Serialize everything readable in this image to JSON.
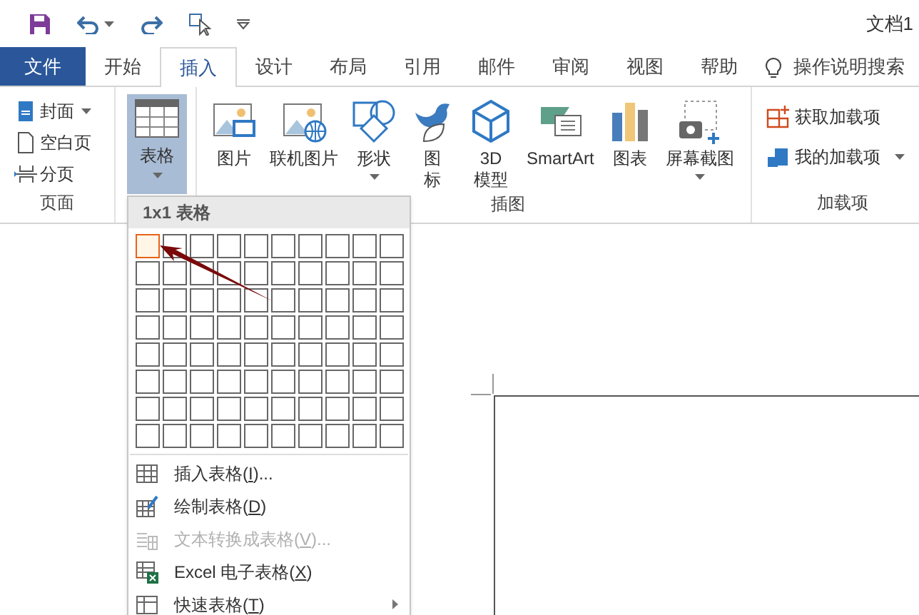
{
  "document_title": "文档1",
  "tabs": [
    {
      "label": "文件",
      "kind": "file",
      "selected": false
    },
    {
      "label": "开始",
      "kind": "tab",
      "selected": false
    },
    {
      "label": "插入",
      "kind": "tab",
      "selected": true
    },
    {
      "label": "设计",
      "kind": "tab",
      "selected": false
    },
    {
      "label": "布局",
      "kind": "tab",
      "selected": false
    },
    {
      "label": "引用",
      "kind": "tab",
      "selected": false
    },
    {
      "label": "邮件",
      "kind": "tab",
      "selected": false
    },
    {
      "label": "审阅",
      "kind": "tab",
      "selected": false
    },
    {
      "label": "视图",
      "kind": "tab",
      "selected": false
    },
    {
      "label": "帮助",
      "kind": "tab",
      "selected": false
    }
  ],
  "tell_me": "操作说明搜索",
  "ribbon": {
    "pages_group": {
      "label": "页面",
      "items": [
        {
          "label": "封面",
          "kind": "cover",
          "dropdown": true
        },
        {
          "label": "空白页",
          "kind": "blank",
          "dropdown": false
        },
        {
          "label": "分页",
          "kind": "break",
          "dropdown": false
        }
      ]
    },
    "table_button": {
      "label": "表格",
      "pressed": true
    },
    "illustrations_group": {
      "label": "插图",
      "items": [
        {
          "lines": [
            "图片"
          ],
          "kind": "picture",
          "dropdown": false
        },
        {
          "lines": [
            "联机图片"
          ],
          "kind": "online",
          "dropdown": false
        },
        {
          "lines": [
            "形状"
          ],
          "kind": "shapes",
          "dropdown": true
        },
        {
          "lines": [
            "图",
            "标"
          ],
          "kind": "icons",
          "dropdown": false
        },
        {
          "lines": [
            "3D",
            "模型"
          ],
          "kind": "model",
          "dropdown": false
        },
        {
          "lines": [
            "SmartArt"
          ],
          "kind": "smartart",
          "dropdown": false
        },
        {
          "lines": [
            "图表"
          ],
          "kind": "chart",
          "dropdown": false
        },
        {
          "lines": [
            "屏幕截图"
          ],
          "kind": "screenshot",
          "dropdown": true
        }
      ]
    },
    "addins_group": {
      "label": "加载项",
      "items": [
        {
          "label": "获取加载项",
          "kind": "store",
          "dropdown": false
        },
        {
          "label": "我的加载项",
          "kind": "mine",
          "dropdown": true
        }
      ]
    }
  },
  "table_menu": {
    "header": "1x1 表格",
    "grid": [
      {
        "cells": [
          {
            "selected": true
          },
          {
            "selected": false
          },
          {
            "selected": false
          },
          {
            "selected": false
          },
          {
            "selected": false
          },
          {
            "selected": false
          },
          {
            "selected": false
          },
          {
            "selected": false
          },
          {
            "selected": false
          },
          {
            "selected": false
          }
        ]
      },
      {
        "cells": [
          {
            "selected": false
          },
          {
            "selected": false
          },
          {
            "selected": false
          },
          {
            "selected": false
          },
          {
            "selected": false
          },
          {
            "selected": false
          },
          {
            "selected": false
          },
          {
            "selected": false
          },
          {
            "selected": false
          },
          {
            "selected": false
          }
        ]
      },
      {
        "cells": [
          {
            "selected": false
          },
          {
            "selected": false
          },
          {
            "selected": false
          },
          {
            "selected": false
          },
          {
            "selected": false
          },
          {
            "selected": false
          },
          {
            "selected": false
          },
          {
            "selected": false
          },
          {
            "selected": false
          },
          {
            "selected": false
          }
        ]
      },
      {
        "cells": [
          {
            "selected": false
          },
          {
            "selected": false
          },
          {
            "selected": false
          },
          {
            "selected": false
          },
          {
            "selected": false
          },
          {
            "selected": false
          },
          {
            "selected": false
          },
          {
            "selected": false
          },
          {
            "selected": false
          },
          {
            "selected": false
          }
        ]
      },
      {
        "cells": [
          {
            "selected": false
          },
          {
            "selected": false
          },
          {
            "selected": false
          },
          {
            "selected": false
          },
          {
            "selected": false
          },
          {
            "selected": false
          },
          {
            "selected": false
          },
          {
            "selected": false
          },
          {
            "selected": false
          },
          {
            "selected": false
          }
        ]
      },
      {
        "cells": [
          {
            "selected": false
          },
          {
            "selected": false
          },
          {
            "selected": false
          },
          {
            "selected": false
          },
          {
            "selected": false
          },
          {
            "selected": false
          },
          {
            "selected": false
          },
          {
            "selected": false
          },
          {
            "selected": false
          },
          {
            "selected": false
          }
        ]
      },
      {
        "cells": [
          {
            "selected": false
          },
          {
            "selected": false
          },
          {
            "selected": false
          },
          {
            "selected": false
          },
          {
            "selected": false
          },
          {
            "selected": false
          },
          {
            "selected": false
          },
          {
            "selected": false
          },
          {
            "selected": false
          },
          {
            "selected": false
          }
        ]
      },
      {
        "cells": [
          {
            "selected": false
          },
          {
            "selected": false
          },
          {
            "selected": false
          },
          {
            "selected": false
          },
          {
            "selected": false
          },
          {
            "selected": false
          },
          {
            "selected": false
          },
          {
            "selected": false
          },
          {
            "selected": false
          },
          {
            "selected": false
          }
        ]
      }
    ],
    "items": [
      {
        "text": "插入表格(",
        "accel": "I",
        "rest": ")...",
        "kind": "grid",
        "disabled": false,
        "submenu": false
      },
      {
        "text": "绘制表格(",
        "accel": "D",
        "rest": ")",
        "kind": "pencil",
        "disabled": false,
        "submenu": false
      },
      {
        "text": "文本转换成表格(",
        "accel": "V",
        "rest": ")...",
        "kind": "convert",
        "disabled": true,
        "submenu": false
      },
      {
        "text": "Excel 电子表格(",
        "accel": "X",
        "rest": ")",
        "kind": "excel",
        "disabled": false,
        "submenu": false
      },
      {
        "text": "快速表格(",
        "accel": "T",
        "rest": ")",
        "kind": "quick",
        "disabled": false,
        "submenu": true
      }
    ]
  }
}
